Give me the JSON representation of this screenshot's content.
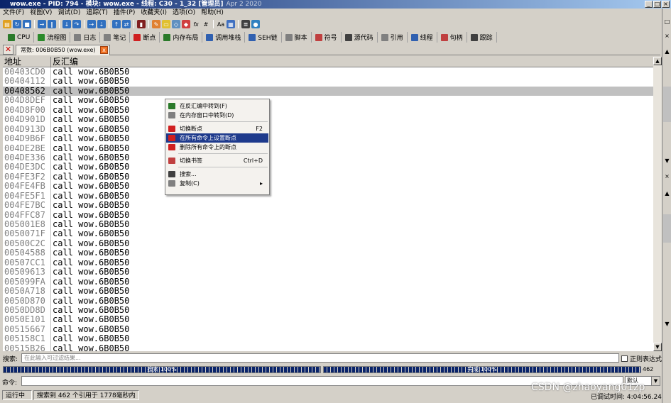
{
  "window": {
    "title": "wow.exe - PID: 794 - 模块: wow.exe - 线程: C30 - 1_32 [管理员]",
    "date": "Apr 2 2020"
  },
  "menu": [
    "文件(F)",
    "视图(V)",
    "调试(D)",
    "追踪(T)",
    "插件(P)",
    "收藏夹(I)",
    "选项(O)",
    "帮助(H)"
  ],
  "tabs2": [
    {
      "label": "CPU",
      "color": "#2a7a2a"
    },
    {
      "label": "流程图",
      "color": "#2a8a2a"
    },
    {
      "label": "日志",
      "color": "#808080"
    },
    {
      "label": "笔记",
      "color": "#808080"
    },
    {
      "label": "断点",
      "color": "#d02020"
    },
    {
      "label": "内存布局",
      "color": "#2a7a2a"
    },
    {
      "label": "调用堆栈",
      "color": "#3060b0"
    },
    {
      "label": "SEH链",
      "color": "#3060b0"
    },
    {
      "label": "脚本",
      "color": "#808080"
    },
    {
      "label": "符号",
      "color": "#c04040"
    },
    {
      "label": "源代码",
      "color": "#404040"
    },
    {
      "label": "引用",
      "color": "#808080"
    },
    {
      "label": "线程",
      "color": "#3060b0"
    },
    {
      "label": "句柄",
      "color": "#c04040"
    },
    {
      "label": "跟踪",
      "color": "#404040"
    }
  ],
  "doc_tab": {
    "label": "常数: 006B0B50 (wow.exe)",
    "close": "x"
  },
  "list_header": {
    "addr": "地址",
    "disasm": "反汇编"
  },
  "rows": [
    {
      "addr": "00403CD0",
      "ins": "call wow.6B0B50"
    },
    {
      "addr": "00404112",
      "ins": "call wow.6B0B50"
    },
    {
      "addr": "00408562",
      "ins": "call wow.6B0B50",
      "selected": true
    },
    {
      "addr": "004D8DEF",
      "ins": "call wow.6B0B50"
    },
    {
      "addr": "004D8F00",
      "ins": "call wow.6B0B50"
    },
    {
      "addr": "004D901D",
      "ins": "call wow.6B0B50"
    },
    {
      "addr": "004D913D",
      "ins": "call wow.6B0B50"
    },
    {
      "addr": "004D9B6F",
      "ins": "call wow.6B0B50"
    },
    {
      "addr": "004DE2BE",
      "ins": "call wow.6B0B50"
    },
    {
      "addr": "004DE336",
      "ins": "call wow.6B0B50"
    },
    {
      "addr": "004DE3DC",
      "ins": "call wow.6B0B50"
    },
    {
      "addr": "004FE3F2",
      "ins": "call wow.6B0B50"
    },
    {
      "addr": "004FE4FB",
      "ins": "call wow.6B0B50"
    },
    {
      "addr": "004FE5F1",
      "ins": "call wow.6B0B50"
    },
    {
      "addr": "004FE7BC",
      "ins": "call wow.6B0B50"
    },
    {
      "addr": "004FFC87",
      "ins": "call wow.6B0B50"
    },
    {
      "addr": "005001E8",
      "ins": "call wow.6B0B50"
    },
    {
      "addr": "0050071F",
      "ins": "call wow.6B0B50"
    },
    {
      "addr": "00500C2C",
      "ins": "call wow.6B0B50"
    },
    {
      "addr": "00504588",
      "ins": "call wow.6B0B50"
    },
    {
      "addr": "00507CC1",
      "ins": "call wow.6B0B50"
    },
    {
      "addr": "00509613",
      "ins": "call wow.6B0B50"
    },
    {
      "addr": "005099FA",
      "ins": "call wow.6B0B50"
    },
    {
      "addr": "0050A718",
      "ins": "call wow.6B0B50"
    },
    {
      "addr": "0050D870",
      "ins": "call wow.6B0B50"
    },
    {
      "addr": "0050DD8D",
      "ins": "call wow.6B0B50"
    },
    {
      "addr": "0050E101",
      "ins": "call wow.6B0B50"
    },
    {
      "addr": "00515667",
      "ins": "call wow.6B0B50"
    },
    {
      "addr": "005158C1",
      "ins": "call wow.6B0B50"
    },
    {
      "addr": "00515B26",
      "ins": "call wow.6B0B50"
    }
  ],
  "context_menu": [
    {
      "label": "在反汇编中转到(F)",
      "shortcut": "",
      "color": "#2a7a2a"
    },
    {
      "label": "在内存窗口中转到(D)",
      "shortcut": "",
      "color": "#808080"
    },
    {
      "sep": true
    },
    {
      "label": "切换断点",
      "shortcut": "F2",
      "color": "#d02020"
    },
    {
      "label": "在所有命令上设置断点",
      "shortcut": "",
      "color": "#d02020",
      "highlight": true
    },
    {
      "label": "删除所有命令上的断点",
      "shortcut": "",
      "color": "#d02020"
    },
    {
      "sep": true
    },
    {
      "label": "切换书签",
      "shortcut": "Ctrl+D",
      "color": "#c04040"
    },
    {
      "sep": true
    },
    {
      "label": "搜索...",
      "shortcut": "",
      "color": "#404040"
    },
    {
      "label": "复制(C)",
      "shortcut": "▸",
      "color": "#808080"
    }
  ],
  "search": {
    "label": "搜索:",
    "placeholder": "在此输入可过滤结果...",
    "regex": "正则表达式"
  },
  "progress": {
    "left_label": "搜索 100%",
    "right_label": "完成 100%",
    "count": "462"
  },
  "command": {
    "label": "命令:",
    "mode": "默认"
  },
  "status": {
    "state": "运行中",
    "message": "搜索到 462 个引用于 1778毫秒内",
    "clock": "已调试时间: 4:04:56.24"
  },
  "watermark": "CSDN @zhaoyang01zp"
}
